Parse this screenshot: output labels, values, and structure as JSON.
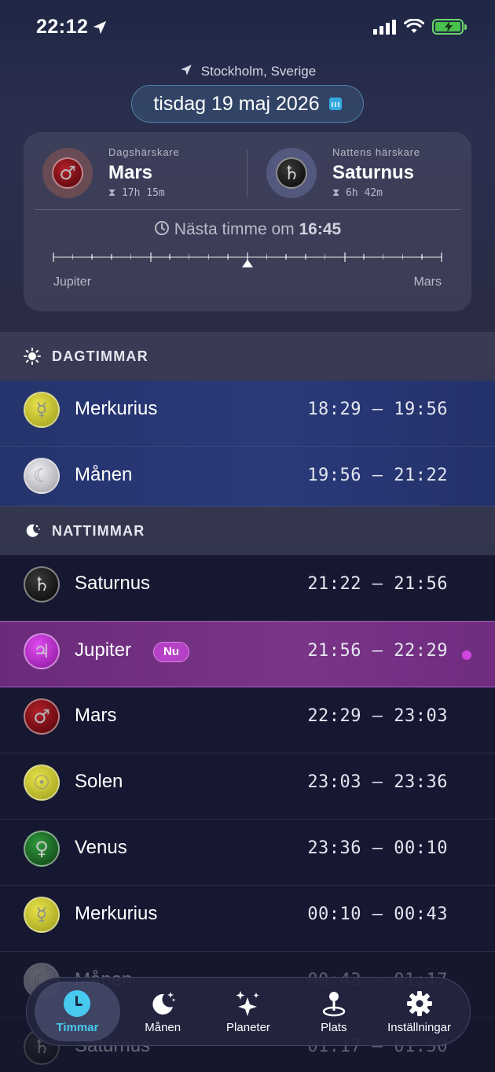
{
  "status": {
    "time": "22:12"
  },
  "header": {
    "location": "Stockholm, Sverige",
    "date": "tisdag 19 maj 2026"
  },
  "rulers": {
    "day": {
      "caption": "Dagshärskare",
      "name": "Mars",
      "symbol": "♂",
      "duration": "17h 15m"
    },
    "night": {
      "caption": "Nattens härskare",
      "name": "Saturnus",
      "symbol": "♄",
      "duration": "6h 42m"
    }
  },
  "next_hour": {
    "prefix": "Nästa timme om",
    "time": "16:45"
  },
  "timeline": {
    "left_label": "Jupiter",
    "right_label": "Mars"
  },
  "sections": {
    "day": {
      "title": "DAGTIMMAR"
    },
    "night": {
      "title": "NATTIMMAR"
    }
  },
  "day_hours": [
    {
      "planet": "Merkurius",
      "symbol": "☿",
      "time": "18:29 – 19:56",
      "color": "#c9c42e"
    },
    {
      "planet": "Månen",
      "symbol": "☾",
      "time": "19:56 – 21:22",
      "color": "#d8d8dc"
    }
  ],
  "night_hours": [
    {
      "planet": "Saturnus",
      "symbol": "♄",
      "time": "21:22 – 21:56",
      "color": "#111111"
    },
    {
      "planet": "Jupiter",
      "symbol": "♃",
      "time": "21:56 – 22:29",
      "color": "#c13ad3",
      "badge": "Nu"
    },
    {
      "planet": "Mars",
      "symbol": "♂",
      "time": "22:29 – 23:03",
      "color": "#7c0e16"
    },
    {
      "planet": "Solen",
      "symbol": "☉",
      "time": "23:03 – 23:36",
      "color": "#c9c42e"
    },
    {
      "planet": "Venus",
      "symbol": "♀",
      "time": "23:36 – 00:10",
      "color": "#217a2e"
    },
    {
      "planet": "Merkurius",
      "symbol": "☿",
      "time": "00:10 – 00:43",
      "color": "#c9c42e"
    },
    {
      "planet": "Månen",
      "symbol": "☾",
      "time": "00:43 – 01:17",
      "color": "#d8d8dc"
    },
    {
      "planet": "Saturnus",
      "symbol": "♄",
      "time": "01:17 – 01:50",
      "color": "#111111"
    }
  ],
  "tabs": [
    {
      "label": "Timmar",
      "icon": "clock-icon",
      "active": true
    },
    {
      "label": "Månen",
      "icon": "moon-stars-icon"
    },
    {
      "label": "Planeter",
      "icon": "sparkles-icon"
    },
    {
      "label": "Plats",
      "icon": "map-pin-icon"
    },
    {
      "label": "Inställningar",
      "icon": "gear-icon"
    }
  ],
  "colors": {
    "accent": "#48c9f0",
    "current_row": "#7a3488",
    "badge": "#b640c6"
  }
}
